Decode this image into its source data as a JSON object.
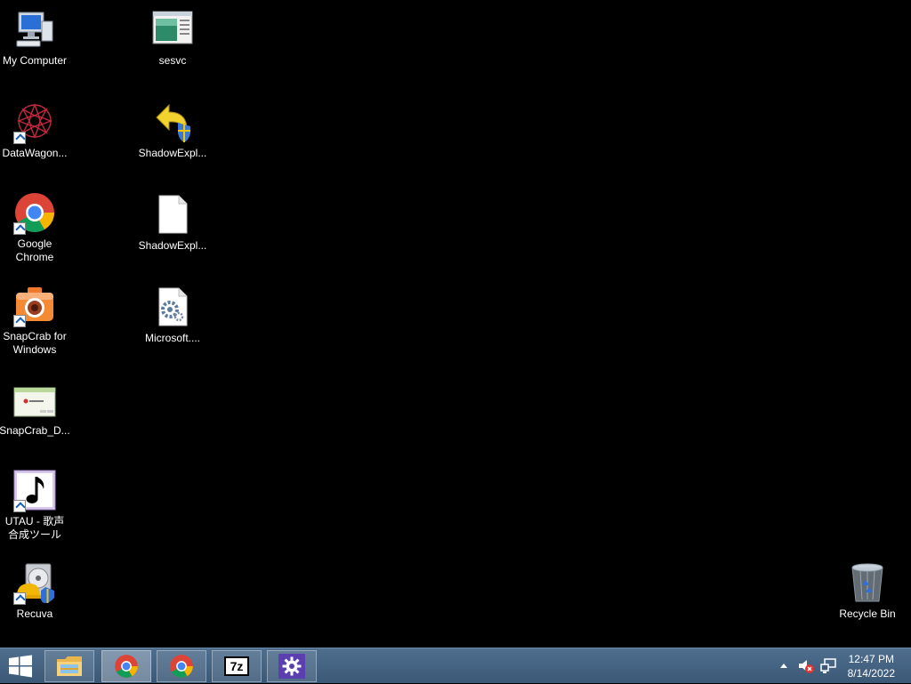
{
  "desktop": {
    "icons": [
      {
        "label": "My Computer",
        "icon": "computer-icon"
      },
      {
        "label": "DataWagon...",
        "icon": "datawagon-icon"
      },
      {
        "label": "Google\nChrome",
        "icon": "chrome-icon"
      },
      {
        "label": "SnapCrab for\nWindows",
        "icon": "camera-icon"
      },
      {
        "label": "SnapCrab_D...",
        "icon": "screenshot-thumbnail-icon"
      },
      {
        "label": "UTAU - 歌声\n合成ツール",
        "icon": "music-note-icon"
      },
      {
        "label": "Recuva",
        "icon": "recuva-icon"
      },
      {
        "label": "sesvc",
        "icon": "window-app-icon"
      },
      {
        "label": "ShadowExpl...",
        "icon": "shadowexplorer-icon"
      },
      {
        "label": "ShadowExpl...",
        "icon": "blank-file-icon"
      },
      {
        "label": "Microsoft....",
        "icon": "config-file-icon"
      },
      {
        "label": "Recycle Bin",
        "icon": "recycle-bin-icon"
      }
    ]
  },
  "taskbar": {
    "buttons": [
      {
        "name": "file-explorer",
        "icon": "folder-icon"
      },
      {
        "name": "chrome-1",
        "icon": "chrome-icon",
        "active": true
      },
      {
        "name": "chrome-2",
        "icon": "chrome-icon"
      },
      {
        "name": "7zip",
        "icon": "7zip-icon",
        "text": "7z"
      },
      {
        "name": "settings",
        "icon": "gear-icon"
      }
    ],
    "clock": {
      "time": "12:47 PM",
      "date": "8/14/2022"
    }
  }
}
